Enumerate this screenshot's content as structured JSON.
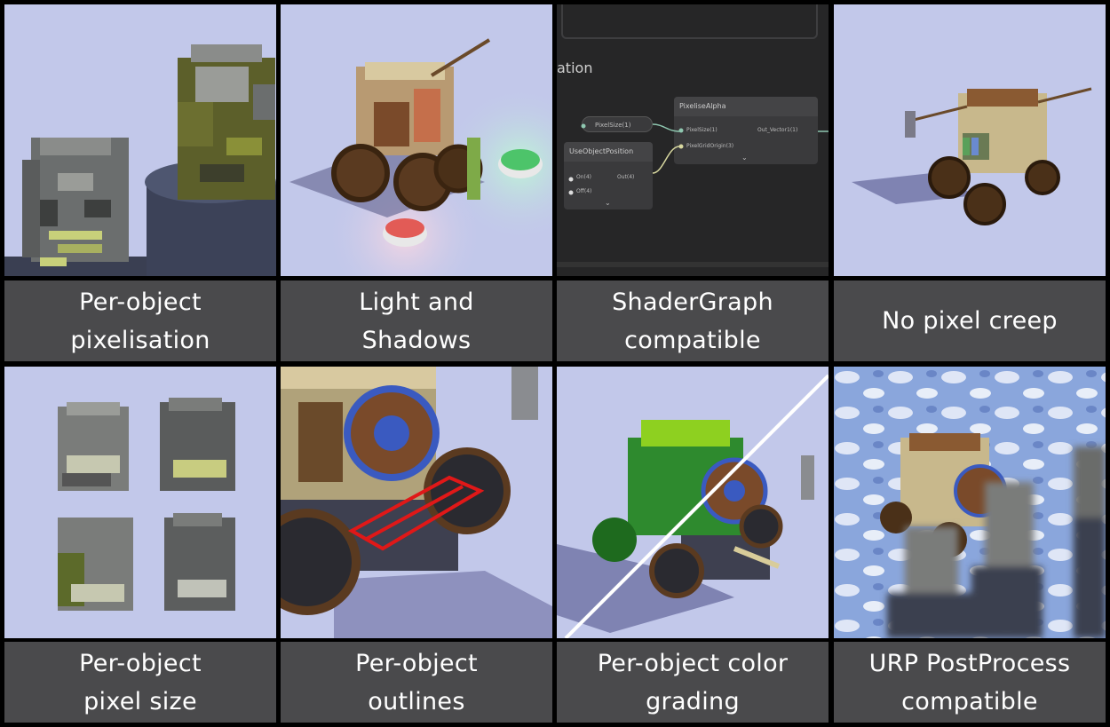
{
  "features": [
    {
      "caption": "Per-object\npixelisation"
    },
    {
      "caption": "Light and\nShadows"
    },
    {
      "caption": "ShaderGraph\ncompatible"
    },
    {
      "caption": "No pixel creep"
    },
    {
      "caption": "Per-object\npixel size"
    },
    {
      "caption": "Per-object\noutlines"
    },
    {
      "caption": "Per-object color\ngrading"
    },
    {
      "caption": "URP PostProcess\ncompatible"
    }
  ],
  "shadergraph": {
    "section_title": "ation",
    "nodes": {
      "pixel_size_property": {
        "label": "PixelSize(1)"
      },
      "pixelise_alpha": {
        "title": "PixeliseAlpha",
        "in_pixel_size": "PixelSize(1)",
        "in_pixel_grid_origin": "PixelGridOrigin(3)",
        "out": "Out_Vector1(1)"
      },
      "use_object_position": {
        "title": "UseObjectPosition",
        "in_on": "On(4)",
        "in_off": "Off(4)",
        "out": "Out(4)"
      }
    }
  },
  "colors": {
    "background": "#c2c8ea",
    "caption_bg": "#4a4a4c",
    "caption_text": "#ffffff",
    "grid_lines": "#000000",
    "node_editor_bg": "#262627",
    "node_bg": "#3a3a3c"
  }
}
